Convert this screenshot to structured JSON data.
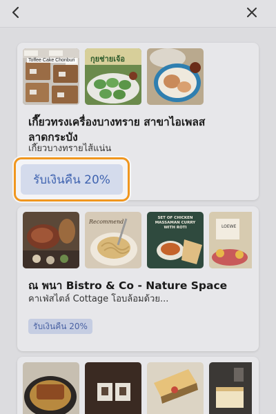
{
  "header": {
    "back_icon": "chevron-left-icon",
    "close_icon": "close-icon"
  },
  "cards": [
    {
      "title": "เกี๊ยวทรงเครื่องบางทราย สาขาไอเพลส ลาดกระบัง",
      "subtitle": "เกี๊ยวบางทรายไส้แน่น",
      "badge": "รับเงินคืน 20%",
      "thumbs": [
        {
          "caption": "Toffee Cake Chonburi"
        },
        {
          "caption": "กุยช่ายเจ้อ"
        },
        {
          "caption": ""
        }
      ]
    },
    {
      "title": "ณ พนา Bistro & Co - Nature Space",
      "subtitle": "คาเฟ่สไตล์ Cottage โอบล้อมด้วย...",
      "badge": "รับเงินคืน 20%",
      "thumbs": [
        {
          "caption": ""
        },
        {
          "caption": "Recommend"
        },
        {
          "caption": "SET OF CHICKEN MASSAMAN CURRY WITH ROTI"
        },
        {
          "caption": "LOEWE"
        }
      ]
    },
    {
      "title": "",
      "subtitle": "",
      "badge": "",
      "thumbs": [
        {
          "caption": ""
        },
        {
          "caption": ""
        },
        {
          "caption": ""
        },
        {
          "caption": ""
        }
      ]
    }
  ]
}
